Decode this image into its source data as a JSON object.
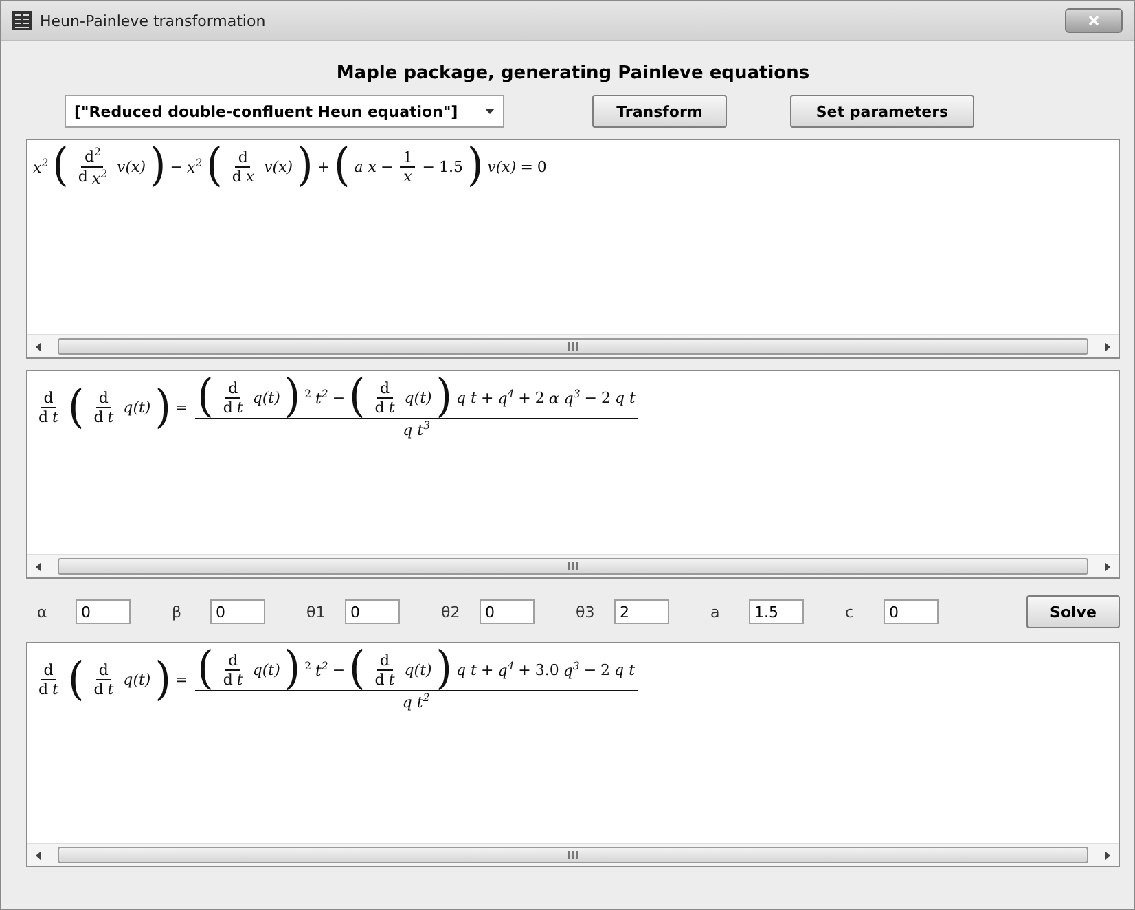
{
  "window": {
    "title": "Heun-Painleve transformation"
  },
  "heading": "Maple package, generating Painleve equations",
  "toolbar": {
    "equation_choice": "[\"Reduced double-confluent Heun equation\"]",
    "buttons": [
      "Transform",
      "Set parameters"
    ]
  },
  "panels": [
    {
      "formula": [
        {
          "kind": "var",
          "text": "x$^{2}$"
        },
        {
          "kind": "paren",
          "text": "("
        },
        {
          "kind": "frac",
          "num": [
            {
              "kind": "op",
              "text": "d$^{2}$"
            }
          ],
          "den": [
            {
              "kind": "op",
              "text": "d"
            },
            {
              "kind": "var",
              "text": "x$^{2}$"
            }
          ]
        },
        {
          "kind": "var",
          "text": "v(x)"
        },
        {
          "kind": "paren",
          "text": ")"
        },
        {
          "kind": "op",
          "text": "−"
        },
        {
          "kind": "var",
          "text": "x$^{2}$"
        },
        {
          "kind": "paren",
          "text": "("
        },
        {
          "kind": "frac",
          "num": [
            {
              "kind": "op",
              "text": "d"
            }
          ],
          "den": [
            {
              "kind": "op",
              "text": "d"
            },
            {
              "kind": "var",
              "text": "x"
            }
          ]
        },
        {
          "kind": "var",
          "text": "v(x)"
        },
        {
          "kind": "paren",
          "text": ")"
        },
        {
          "kind": "op",
          "text": "+"
        },
        {
          "kind": "paren",
          "text": "("
        },
        {
          "kind": "var",
          "text": "a x"
        },
        {
          "kind": "op",
          "text": "−"
        },
        {
          "kind": "frac",
          "num": [
            {
              "kind": "op",
              "text": "1"
            }
          ],
          "den": [
            {
              "kind": "var",
              "text": "x"
            }
          ]
        },
        {
          "kind": "op",
          "text": "−"
        },
        {
          "kind": "op",
          "text": "1.5"
        },
        {
          "kind": "paren",
          "text": ")"
        },
        {
          "kind": "var",
          "text": "v(x)"
        },
        {
          "kind": "op",
          "text": "="
        },
        {
          "kind": "op",
          "text": "0"
        }
      ]
    },
    {
      "formula": [
        {
          "kind": "frac",
          "num": [
            {
              "kind": "op",
              "text": "d"
            }
          ],
          "den": [
            {
              "kind": "op",
              "text": "d"
            },
            {
              "kind": "var",
              "text": "t"
            }
          ]
        },
        {
          "kind": "paren",
          "text": "("
        },
        {
          "kind": "frac",
          "num": [
            {
              "kind": "op",
              "text": "d"
            }
          ],
          "den": [
            {
              "kind": "op",
              "text": "d"
            },
            {
              "kind": "var",
              "text": "t"
            }
          ]
        },
        {
          "kind": "var",
          "text": "q(t)"
        },
        {
          "kind": "paren",
          "text": ")"
        },
        {
          "kind": "op",
          "text": "="
        },
        {
          "kind": "frac",
          "num": [
            {
              "kind": "paren",
              "text": "("
            },
            {
              "kind": "frac",
              "num": [
                {
                  "kind": "op",
                  "text": "d"
                }
              ],
              "den": [
                {
                  "kind": "op",
                  "text": "d"
                },
                {
                  "kind": "var",
                  "text": "t"
                }
              ]
            },
            {
              "kind": "var",
              "text": "q(t)"
            },
            {
              "kind": "paren",
              "text": ")"
            },
            {
              "kind": "op",
              "text": "$^{2}$"
            },
            {
              "kind": "var",
              "text": "t$^{2}$"
            },
            {
              "kind": "op",
              "text": "−"
            },
            {
              "kind": "paren",
              "text": "("
            },
            {
              "kind": "frac",
              "num": [
                {
                  "kind": "op",
                  "text": "d"
                }
              ],
              "den": [
                {
                  "kind": "op",
                  "text": "d"
                },
                {
                  "kind": "var",
                  "text": "t"
                }
              ]
            },
            {
              "kind": "var",
              "text": "q(t)"
            },
            {
              "kind": "paren",
              "text": ")"
            },
            {
              "kind": "var",
              "text": "q t"
            },
            {
              "kind": "op",
              "text": "+"
            },
            {
              "kind": "var",
              "text": "q$^{4}$"
            },
            {
              "kind": "op",
              "text": "+"
            },
            {
              "kind": "op",
              "text": "2"
            },
            {
              "kind": "var",
              "text": "α q$^{3}$"
            },
            {
              "kind": "op",
              "text": "−"
            },
            {
              "kind": "op",
              "text": "2"
            },
            {
              "kind": "var",
              "text": "q t"
            }
          ],
          "den": [
            {
              "kind": "var",
              "text": "q t$^{3}$"
            }
          ]
        }
      ]
    },
    {
      "formula": [
        {
          "kind": "frac",
          "num": [
            {
              "kind": "op",
              "text": "d"
            }
          ],
          "den": [
            {
              "kind": "op",
              "text": "d"
            },
            {
              "kind": "var",
              "text": "t"
            }
          ]
        },
        {
          "kind": "paren",
          "text": "("
        },
        {
          "kind": "frac",
          "num": [
            {
              "kind": "op",
              "text": "d"
            }
          ],
          "den": [
            {
              "kind": "op",
              "text": "d"
            },
            {
              "kind": "var",
              "text": "t"
            }
          ]
        },
        {
          "kind": "var",
          "text": "q(t)"
        },
        {
          "kind": "paren",
          "text": ")"
        },
        {
          "kind": "op",
          "text": "="
        },
        {
          "kind": "frac",
          "num": [
            {
              "kind": "paren",
              "text": "("
            },
            {
              "kind": "frac",
              "num": [
                {
                  "kind": "op",
                  "text": "d"
                }
              ],
              "den": [
                {
                  "kind": "op",
                  "text": "d"
                },
                {
                  "kind": "var",
                  "text": "t"
                }
              ]
            },
            {
              "kind": "var",
              "text": "q(t)"
            },
            {
              "kind": "paren",
              "text": ")"
            },
            {
              "kind": "op",
              "text": "$^{2}$"
            },
            {
              "kind": "var",
              "text": "t$^{2}$"
            },
            {
              "kind": "op",
              "text": "−"
            },
            {
              "kind": "paren",
              "text": "("
            },
            {
              "kind": "frac",
              "num": [
                {
                  "kind": "op",
                  "text": "d"
                }
              ],
              "den": [
                {
                  "kind": "op",
                  "text": "d"
                },
                {
                  "kind": "var",
                  "text": "t"
                }
              ]
            },
            {
              "kind": "var",
              "text": "q(t)"
            },
            {
              "kind": "paren",
              "text": ")"
            },
            {
              "kind": "var",
              "text": "q t"
            },
            {
              "kind": "op",
              "text": "+"
            },
            {
              "kind": "var",
              "text": "q$^{4}$"
            },
            {
              "kind": "op",
              "text": "+"
            },
            {
              "kind": "op",
              "text": "3.0"
            },
            {
              "kind": "var",
              "text": "q$^{3}$"
            },
            {
              "kind": "op",
              "text": "−"
            },
            {
              "kind": "op",
              "text": "2"
            },
            {
              "kind": "var",
              "text": "q t"
            }
          ],
          "den": [
            {
              "kind": "var",
              "text": "q t$^{2}$"
            }
          ]
        }
      ]
    }
  ],
  "parameters": [
    {
      "label": "α",
      "value": "0"
    },
    {
      "label": "β",
      "value": "0"
    },
    {
      "label": "θ1",
      "value": "0"
    },
    {
      "label": "θ2",
      "value": "0"
    },
    {
      "label": "θ3",
      "value": "2"
    },
    {
      "label": "a",
      "value": "1.5"
    },
    {
      "label": "c",
      "value": "0"
    }
  ],
  "solve_button": "Solve"
}
